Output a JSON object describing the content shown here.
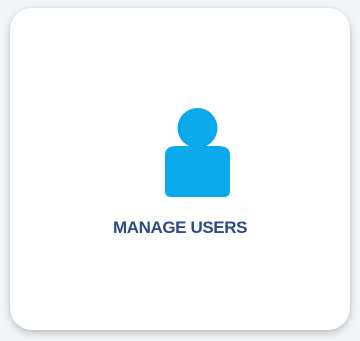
{
  "tile": {
    "label": "MANAGE USERS",
    "icon": "user-icon"
  },
  "colors": {
    "icon": "#0ba8ec",
    "label": "#2d4a86",
    "card": "#ffffff",
    "background": "#f2f5f8"
  }
}
